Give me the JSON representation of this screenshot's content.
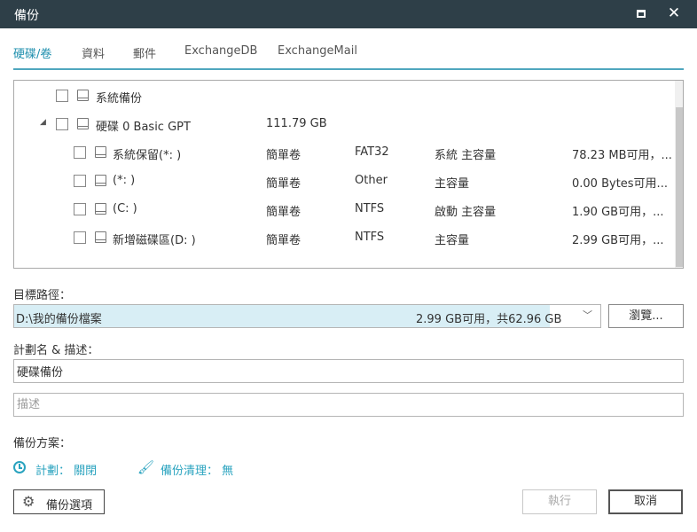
{
  "window": {
    "title": "備份",
    "maximize_icon": "maximize-icon",
    "close_label": "✕"
  },
  "tabs": [
    {
      "label": "硬碟/卷",
      "active": true
    },
    {
      "label": "資料",
      "active": false
    },
    {
      "label": "郵件",
      "active": false
    },
    {
      "label": "ExchangeDB",
      "active": false
    },
    {
      "label": "ExchangeMail",
      "active": false
    }
  ],
  "tree": {
    "rows": [
      {
        "name": "系統備份",
        "type": "",
        "fs": "",
        "role": "",
        "space": ""
      },
      {
        "name": "硬碟 0 Basic GPT",
        "type": "111.79 GB",
        "fs": "",
        "role": "",
        "space": ""
      },
      {
        "name": "系統保留(*: )",
        "type": "簡單卷",
        "fs": "FAT32",
        "role": "系統 主容量",
        "space": "78.23 MB可用，..."
      },
      {
        "name": "(*: )",
        "type": "簡單卷",
        "fs": "Other",
        "role": "主容量",
        "space": "0.00 Bytes可用..."
      },
      {
        "name": "(C: )",
        "type": "簡單卷",
        "fs": "NTFS",
        "role": "啟動 主容量",
        "space": "1.90 GB可用，..."
      },
      {
        "name": "新增磁碟區(D: )",
        "type": "簡單卷",
        "fs": "NTFS",
        "role": "主容量",
        "space": "2.99 GB可用，..."
      }
    ],
    "expander_glyph": "◢"
  },
  "destination": {
    "label": "目標路徑：",
    "path": "D:\\我的備份檔案",
    "space": "2.99 GB可用，共62.96 GB",
    "dropdown_glyph": "﹀",
    "browse_label": "瀏覽..."
  },
  "plan": {
    "label": "計劃名 & 描述：",
    "name_value": "硬碟備份",
    "description_placeholder": "描述"
  },
  "scheme": {
    "label": "備份方案：",
    "schedule": "計劃： 關閉",
    "cleanup": "備份清理： 無",
    "schedule_icon": "clock-icon",
    "cleanup_icon": "brush-icon"
  },
  "footer": {
    "options_label": "備份選項",
    "options_icon": "gear-icon",
    "run_label": "執行",
    "cancel_label": "取消"
  },
  "colors": {
    "titlebar": "#2e3f48",
    "accent": "#1f8fae",
    "link": "#2aa3bf",
    "selection": "#d8eef5"
  }
}
